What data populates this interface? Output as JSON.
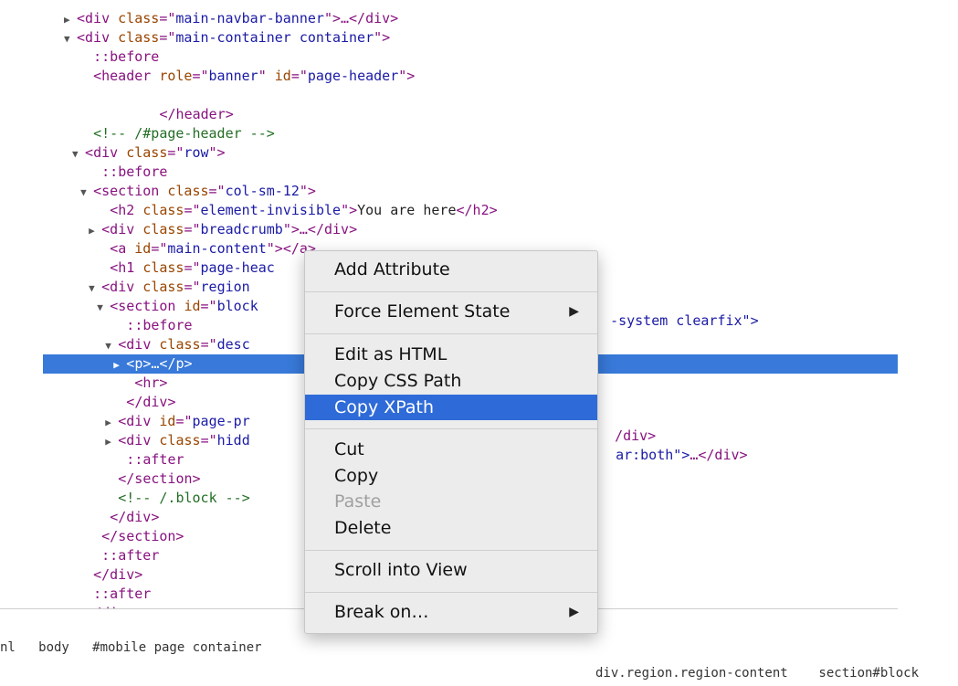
{
  "elements_tree": [
    {
      "indent": 4,
      "tri": "▶",
      "parts": [
        [
          "tag",
          "<div "
        ],
        [
          "attr",
          "class"
        ],
        [
          "tag",
          "=\""
        ],
        [
          "val",
          "main-navbar-banner"
        ],
        [
          "tag",
          "\">…</div>"
        ]
      ]
    },
    {
      "indent": 4,
      "tri": "▼",
      "parts": [
        [
          "tag",
          "<div "
        ],
        [
          "attr",
          "class"
        ],
        [
          "tag",
          "=\""
        ],
        [
          "val",
          "main-container container"
        ],
        [
          "tag",
          "\">"
        ]
      ]
    },
    {
      "indent": 6,
      "tri": "",
      "parts": [
        [
          "tag",
          "::before"
        ]
      ]
    },
    {
      "indent": 6,
      "tri": "",
      "parts": [
        [
          "tag",
          "<header "
        ],
        [
          "attr",
          "role"
        ],
        [
          "tag",
          "=\""
        ],
        [
          "val",
          "banner"
        ],
        [
          "tag",
          "\" "
        ],
        [
          "attr",
          "id"
        ],
        [
          "tag",
          "=\""
        ],
        [
          "val",
          "page-header"
        ],
        [
          "tag",
          "\">"
        ]
      ]
    },
    {
      "indent": 0,
      "tri": "",
      "parts": []
    },
    {
      "indent": 14,
      "tri": "",
      "parts": [
        [
          "tag",
          "</header>"
        ]
      ]
    },
    {
      "indent": 6,
      "tri": "",
      "parts": [
        [
          "com",
          "<!-- /#page-header -->"
        ]
      ]
    },
    {
      "indent": 5,
      "tri": "▼",
      "parts": [
        [
          "tag",
          "<div "
        ],
        [
          "attr",
          "class"
        ],
        [
          "tag",
          "=\""
        ],
        [
          "val",
          "row"
        ],
        [
          "tag",
          "\">"
        ]
      ]
    },
    {
      "indent": 7,
      "tri": "",
      "parts": [
        [
          "tag",
          "::before"
        ]
      ]
    },
    {
      "indent": 6,
      "tri": "▼",
      "parts": [
        [
          "tag",
          "<section "
        ],
        [
          "attr",
          "class"
        ],
        [
          "tag",
          "=\""
        ],
        [
          "val",
          "col-sm-12"
        ],
        [
          "tag",
          "\">"
        ]
      ]
    },
    {
      "indent": 8,
      "tri": "",
      "parts": [
        [
          "tag",
          "<h2 "
        ],
        [
          "attr",
          "class"
        ],
        [
          "tag",
          "=\""
        ],
        [
          "val",
          "element-invisible"
        ],
        [
          "tag",
          "\">"
        ],
        [
          "txt",
          "You are here"
        ],
        [
          "tag",
          "</h2>"
        ]
      ]
    },
    {
      "indent": 7,
      "tri": "▶",
      "parts": [
        [
          "tag",
          "<div "
        ],
        [
          "attr",
          "class"
        ],
        [
          "tag",
          "=\""
        ],
        [
          "val",
          "breadcrumb"
        ],
        [
          "tag",
          "\">…</div>"
        ]
      ]
    },
    {
      "indent": 8,
      "tri": "",
      "parts": [
        [
          "tag",
          "<a "
        ],
        [
          "attr",
          "id"
        ],
        [
          "tag",
          "=\""
        ],
        [
          "val",
          "main-content"
        ],
        [
          "tag",
          "\"></a>"
        ]
      ]
    },
    {
      "indent": 8,
      "tri": "",
      "parts": [
        [
          "tag",
          "<h1 "
        ],
        [
          "attr",
          "class"
        ],
        [
          "tag",
          "=\""
        ],
        [
          "val",
          "page-heac"
        ]
      ]
    },
    {
      "indent": 7,
      "tri": "▼",
      "parts": [
        [
          "tag",
          "<div "
        ],
        [
          "attr",
          "class"
        ],
        [
          "tag",
          "=\""
        ],
        [
          "val",
          "region "
        ]
      ]
    },
    {
      "indent": 8,
      "tri": "▼",
      "parts": [
        [
          "tag",
          "<section "
        ],
        [
          "attr",
          "id"
        ],
        [
          "tag",
          "=\""
        ],
        [
          "val",
          "block"
        ]
      ]
    },
    {
      "indent": 10,
      "tri": "",
      "parts": [
        [
          "tag",
          "::before"
        ]
      ]
    },
    {
      "indent": 9,
      "tri": "▼",
      "parts": [
        [
          "tag",
          "<div "
        ],
        [
          "attr",
          "class"
        ],
        [
          "tag",
          "=\""
        ],
        [
          "val",
          "desc"
        ]
      ]
    },
    {
      "indent": 10,
      "tri": "▶",
      "parts": [
        [
          "tag",
          "<p>…</p>"
        ]
      ],
      "selected": true
    },
    {
      "indent": 11,
      "tri": "",
      "parts": [
        [
          "tag",
          "<hr>"
        ]
      ]
    },
    {
      "indent": 10,
      "tri": "",
      "parts": [
        [
          "tag",
          "</div>"
        ]
      ]
    },
    {
      "indent": 9,
      "tri": "▶",
      "parts": [
        [
          "tag",
          "<div "
        ],
        [
          "attr",
          "id"
        ],
        [
          "tag",
          "=\""
        ],
        [
          "val",
          "page-pr"
        ]
      ]
    },
    {
      "indent": 9,
      "tri": "▶",
      "parts": [
        [
          "tag",
          "<div "
        ],
        [
          "attr",
          "class"
        ],
        [
          "tag",
          "=\""
        ],
        [
          "val",
          "hidd"
        ]
      ]
    },
    {
      "indent": 10,
      "tri": "",
      "parts": [
        [
          "tag",
          "::after"
        ]
      ]
    },
    {
      "indent": 9,
      "tri": "",
      "parts": [
        [
          "tag",
          "</section>"
        ]
      ]
    },
    {
      "indent": 9,
      "tri": "",
      "parts": [
        [
          "com",
          "<!-- /.block -->"
        ]
      ]
    },
    {
      "indent": 8,
      "tri": "",
      "parts": [
        [
          "tag",
          "</div>"
        ]
      ]
    },
    {
      "indent": 7,
      "tri": "",
      "parts": [
        [
          "tag",
          "</section>"
        ]
      ]
    },
    {
      "indent": 7,
      "tri": "",
      "parts": [
        [
          "tag",
          "::after"
        ]
      ]
    },
    {
      "indent": 6,
      "tri": "",
      "parts": [
        [
          "tag",
          "</div>"
        ]
      ]
    },
    {
      "indent": 6,
      "tri": "",
      "parts": [
        [
          "tag",
          "::after"
        ]
      ]
    },
    {
      "indent": 5,
      "tri": "",
      "parts": [
        [
          "tag",
          "</div>"
        ]
      ]
    }
  ],
  "right_fragments": {
    "section_tail": "-system clearfix\">",
    "div_page_tail": "/div>",
    "div_hidden_tail_a": "ar:both\">",
    "div_hidden_tail_b": "…</div>"
  },
  "statusbar": {
    "text": "nl   body   #mobile page container",
    "right_text": "div.region.region-content    section#block"
  },
  "context_menu": {
    "items": [
      {
        "label": "Add Attribute",
        "submenu": false,
        "state": "normal"
      },
      {
        "label": "Force Element State",
        "submenu": true,
        "state": "normal"
      },
      {
        "label": "Edit as HTML",
        "submenu": false,
        "state": "normal"
      },
      {
        "label": "Copy CSS Path",
        "submenu": false,
        "state": "normal"
      },
      {
        "label": "Copy XPath",
        "submenu": false,
        "state": "active"
      },
      {
        "label": "Cut",
        "submenu": false,
        "state": "normal"
      },
      {
        "label": "Copy",
        "submenu": false,
        "state": "normal"
      },
      {
        "label": "Paste",
        "submenu": false,
        "state": "disabled"
      },
      {
        "label": "Delete",
        "submenu": false,
        "state": "normal"
      },
      {
        "label": "Scroll into View",
        "submenu": false,
        "state": "normal"
      },
      {
        "label": "Break on…",
        "submenu": true,
        "state": "normal"
      }
    ],
    "submenu_arrow": "▶"
  },
  "colors": {
    "selection": "#3879d9",
    "menu_highlight": "#2f6bd8",
    "tag": "#881280",
    "attr": "#994500",
    "value": "#1a1aa6",
    "comment": "#236e25"
  }
}
